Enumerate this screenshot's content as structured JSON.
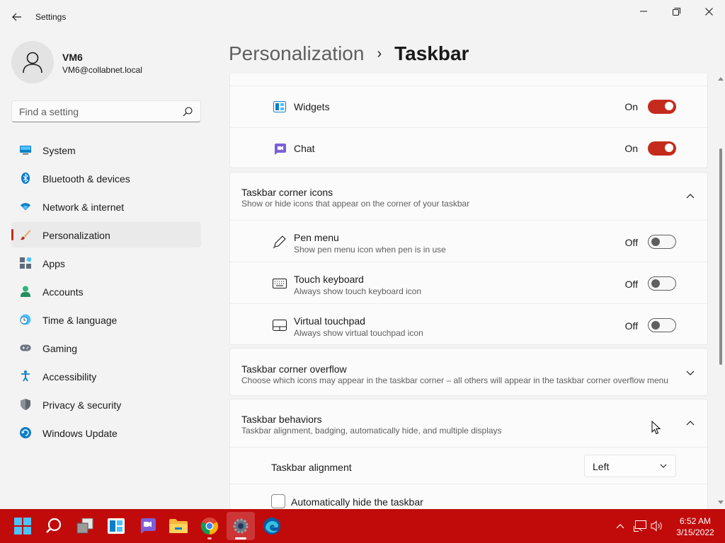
{
  "window": {
    "title": "Settings"
  },
  "profile": {
    "name": "VM6",
    "email": "VM6@collabnet.local"
  },
  "search": {
    "placeholder": "Find a setting"
  },
  "sidebar": {
    "items": [
      {
        "label": "System",
        "icon": "monitor-icon"
      },
      {
        "label": "Bluetooth & devices",
        "icon": "bluetooth-icon"
      },
      {
        "label": "Network & internet",
        "icon": "wifi-icon"
      },
      {
        "label": "Personalization",
        "icon": "paintbrush-icon",
        "selected": true
      },
      {
        "label": "Apps",
        "icon": "apps-icon"
      },
      {
        "label": "Accounts",
        "icon": "person-icon"
      },
      {
        "label": "Time & language",
        "icon": "clock-globe-icon"
      },
      {
        "label": "Gaming",
        "icon": "gamepad-icon"
      },
      {
        "label": "Accessibility",
        "icon": "accessibility-icon"
      },
      {
        "label": "Privacy & security",
        "icon": "shield-icon"
      },
      {
        "label": "Windows Update",
        "icon": "update-icon"
      }
    ]
  },
  "header": {
    "parent": "Personalization",
    "separator": "›",
    "current": "Taskbar"
  },
  "taskbar_items": {
    "widgets": {
      "label": "Widgets",
      "state": "On"
    },
    "chat": {
      "label": "Chat",
      "state": "On"
    }
  },
  "corner_icons": {
    "title": "Taskbar corner icons",
    "subtitle": "Show or hide icons that appear on the corner of your taskbar",
    "pen": {
      "title": "Pen menu",
      "subtitle": "Show pen menu icon when pen is in use",
      "state": "Off"
    },
    "keyboard": {
      "title": "Touch keyboard",
      "subtitle": "Always show touch keyboard icon",
      "state": "Off"
    },
    "touchpad": {
      "title": "Virtual touchpad",
      "subtitle": "Always show virtual touchpad icon",
      "state": "Off"
    }
  },
  "corner_overflow": {
    "title": "Taskbar corner overflow",
    "subtitle": "Choose which icons may appear in the taskbar corner – all others will appear in the taskbar corner overflow menu"
  },
  "behaviors": {
    "title": "Taskbar behaviors",
    "subtitle": "Taskbar alignment, badging, automatically hide, and multiple displays",
    "alignment_label": "Taskbar alignment",
    "alignment_value": "Left",
    "autohide_label": "Automatically hide the taskbar"
  },
  "clock": {
    "time": "6:52 AM",
    "date": "3/15/2022"
  },
  "colors": {
    "accent": "#c42b1c",
    "taskbar": "#c10a0a"
  }
}
